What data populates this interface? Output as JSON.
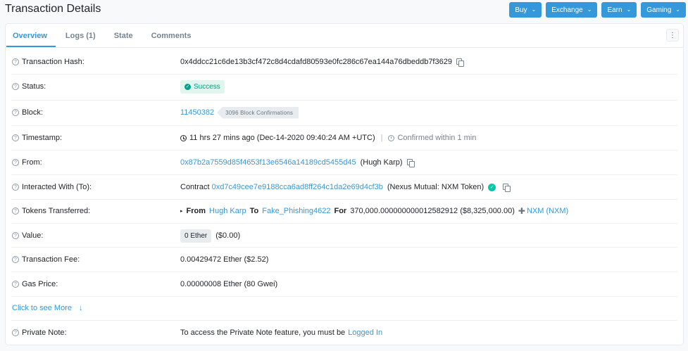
{
  "page_title": "Transaction Details",
  "top_buttons": [
    {
      "label": "Buy"
    },
    {
      "label": "Exchange"
    },
    {
      "label": "Earn"
    },
    {
      "label": "Gaming"
    }
  ],
  "tabs": [
    {
      "label": "Overview"
    },
    {
      "label": "Logs (1)"
    },
    {
      "label": "State"
    },
    {
      "label": "Comments"
    }
  ],
  "help_glyph": "?",
  "rows": {
    "hash": {
      "label": "Transaction Hash:",
      "value": "0x4ddcc21c6de13b3cf472c8d4cdafd80593e0fc286c67ea144a76dbeddb7f3629"
    },
    "status": {
      "label": "Status:",
      "value": "Success"
    },
    "block": {
      "label": "Block:",
      "value": "11450382",
      "confirmations": "3096 Block Confirmations"
    },
    "timestamp": {
      "label": "Timestamp:",
      "value": "11 hrs 27 mins ago (Dec-14-2020 09:40:24 AM +UTC)",
      "separator": "|",
      "confirmed": "Confirmed within 1 min"
    },
    "from": {
      "label": "From:",
      "address": "0x87b2a7559d85f4653f13e6546a14189cd5455d45",
      "name": "(Hugh Karp)"
    },
    "to": {
      "label": "Interacted With (To):",
      "prefix": "Contract",
      "address": "0xd7c49cee7e9188cca6ad8ff264c1da2e69d4cf3b",
      "name": "(Nexus Mutual: NXM Token)"
    },
    "tokens": {
      "label": "Tokens Transferred:",
      "from_label": "From",
      "from_name": "Hugh Karp",
      "to_label": "To",
      "to_name": "Fake_Phishing4622",
      "for_label": "For",
      "amount": "370,000.000000000012582912 ($8,325,000.00)",
      "token_name": "NXM (NXM)"
    },
    "value": {
      "label": "Value:",
      "ether": "0 Ether",
      "usd": "($0.00)"
    },
    "fee": {
      "label": "Transaction Fee:",
      "value": "0.00429472 Ether ($2.52)"
    },
    "gas": {
      "label": "Gas Price:",
      "value": "0.00000008 Ether (80 Gwei)"
    },
    "more": {
      "label": "Click to see More",
      "arrow": "↓"
    },
    "note": {
      "label": "Private Note:",
      "text": "To access the Private Note feature, you must be",
      "link": "Logged In"
    }
  },
  "colors": {
    "accent": "#3498db",
    "success": "#00a186",
    "success_bg": "#dff5ed"
  },
  "icons": {
    "kebab": "⋮",
    "chevron": "⌄",
    "check": "✓",
    "caret_right": "▸",
    "token": "✚"
  }
}
